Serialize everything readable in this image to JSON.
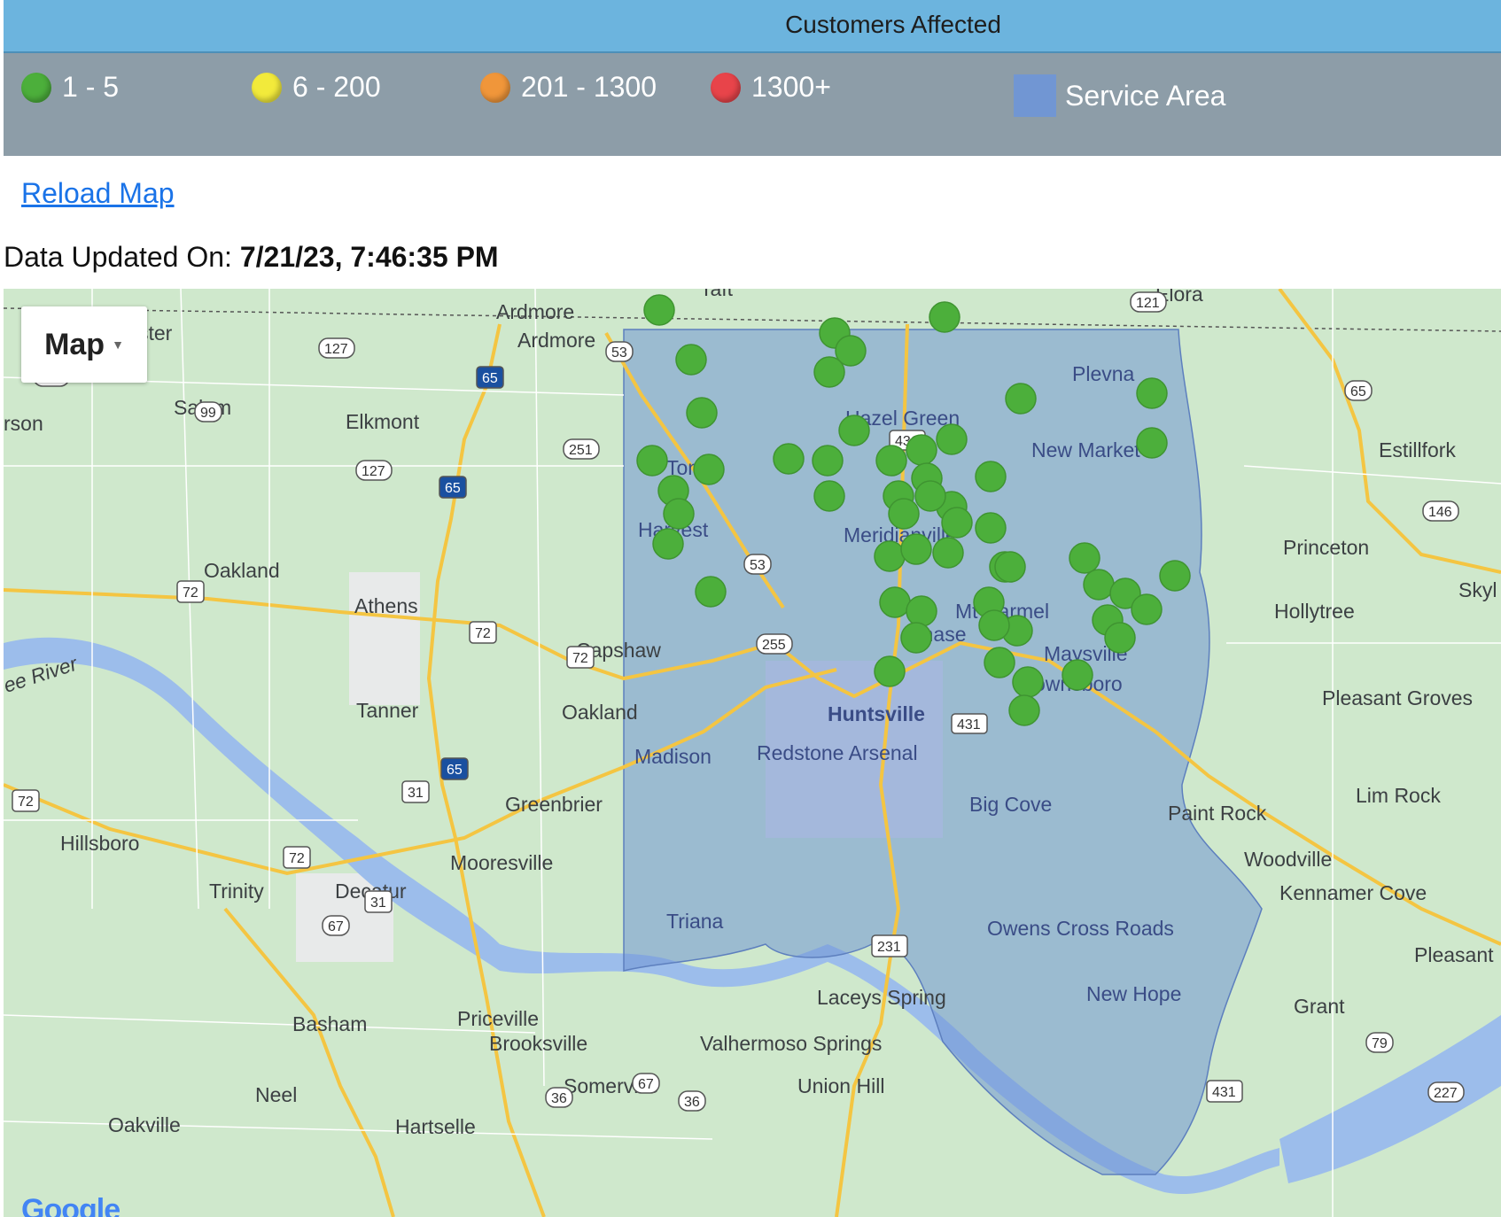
{
  "header": {
    "title": "Customers Affected"
  },
  "legend": [
    {
      "label": "1 - 5",
      "color": "#4caf3b"
    },
    {
      "label": "6 - 200",
      "color": "#f2ea3b"
    },
    {
      "label": "201 - 1300",
      "color": "#f0963a"
    },
    {
      "label": "1300+",
      "color": "#e8444a"
    },
    {
      "label": "Service Area",
      "color": "#7196d3"
    }
  ],
  "reload": {
    "label": "Reload Map"
  },
  "updated": {
    "label": "Data Updated On:",
    "value": "7/21/23, 7:46:35 PM"
  },
  "map": {
    "type_control": {
      "label": "Map"
    },
    "attribution": "Google",
    "places": [
      "Ardmore",
      "Ardmore",
      "ster",
      "Salem",
      "Elkmont",
      "rson",
      "Toney",
      "Hazel Green",
      "Harvest",
      "Meridianville",
      "Plevna",
      "New Market",
      "Estillfork",
      "Princeton",
      "Skyl",
      "Oakland",
      "Athens",
      "Capshaw",
      "Mt Carmel",
      "Chase",
      "Maysville",
      "Brownsboro",
      "Hollytree",
      "Tanner",
      "Oakland",
      "Madison",
      "Redstone Arsenal",
      "Huntsville",
      "Pleasant Groves",
      "Greenbrier",
      "Paint Rock",
      "Lim Rock",
      "Hillsboro",
      "Mooresville",
      "Trinity",
      "Decatur",
      "Woodville",
      "Kennamer Cove",
      "Triana",
      "Owens Cross Roads",
      "Pleasant",
      "New Hope",
      "Grant",
      "Laceys Spring",
      "Basham",
      "Priceville",
      "Brooksville",
      "Valhermoso Springs",
      "Somerville",
      "Union Hill",
      "Neel",
      "Oakville",
      "Hartselle",
      "ee River",
      "Elora",
      "Taft",
      "Big Cove"
    ],
    "marker_color": "#4caf3b",
    "service_area_color": "#7196d3"
  }
}
